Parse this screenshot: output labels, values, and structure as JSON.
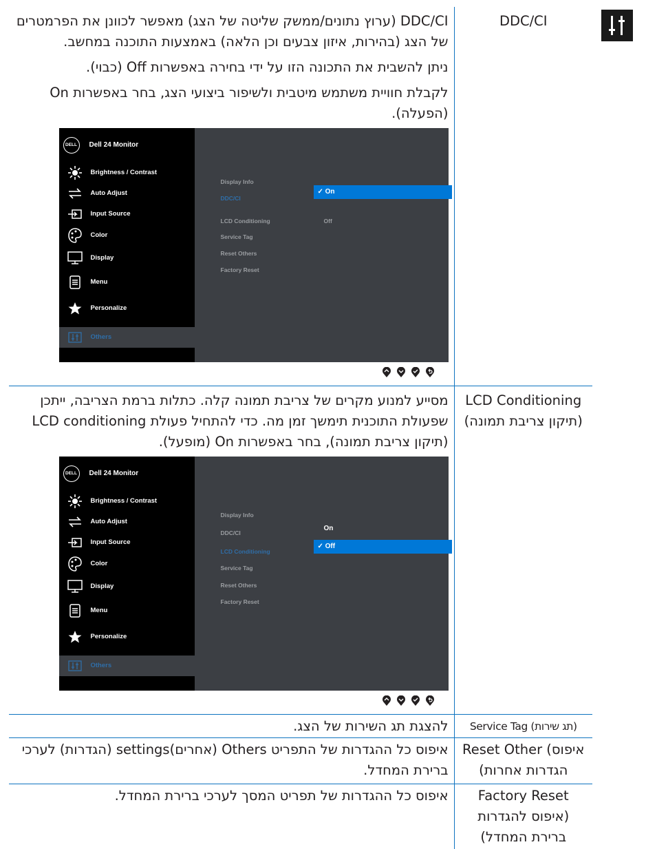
{
  "side_icon": "others-sliders-icon",
  "rows": [
    {
      "label_line1": "DDC/CI",
      "label_line2": "",
      "paragraphs": [
        "DDC/CI (ערוץ נתונים/ממשק שליטה של הצג) מאפשר לכוונן את הפרמטרים של הצג (בהירות, איזון צבעים וכן הלאה) באמצעות התוכנה במחשב.",
        "ניתן להשבית את התכונה הזו על ידי בחירה באפשרות Off (כבוי).",
        "לקבלת חוויית משתמש מיטבית ולשיפור ביצועי הצג, בחר באפשרות On (הפעלה)."
      ]
    },
    {
      "label_line1": "LCD Conditioning",
      "label_line2": "(תיקון צריבת תמונה)",
      "paragraphs": [
        "מסייע למנוע מקרים של צריבת תמונה קלה. כתלות ברמת הצריבה, ייתכן שפעולת התוכנית תימשך זמן מה. כדי להתחיל פעולת LCD conditioning (תיקון צריבת תמונה), בחר באפשרות On (מופעל)."
      ]
    },
    {
      "label_line1": "Service Tag (תג שירות)",
      "label_line2": "",
      "paragraphs": [
        "להצגת תג השירות של הצג."
      ]
    },
    {
      "label_line1": "Reset Other (איפוס",
      "label_line2": "הגדרות אחרות)",
      "paragraphs": [
        "איפוס כל ההגדרות של התפריט Others (אחרים)settings (הגדרות) לערכי ברירת המחדל."
      ]
    },
    {
      "label_line1": "Factory Reset",
      "label_line2": "(איפוס להגדרות ברירת המחדל)",
      "paragraphs": [
        "איפוס כל ההגדרות של תפריט המסך לערכי ברירת המחדל."
      ]
    }
  ],
  "osd": {
    "logo": "DELL",
    "title": "Dell 24 Monitor",
    "menu": [
      {
        "label": "Brightness / Contrast",
        "icon": "brightness-icon"
      },
      {
        "label": "Auto Adjust",
        "icon": "auto-adjust-icon"
      },
      {
        "label": "Input Source",
        "icon": "input-source-icon"
      },
      {
        "label": "Color",
        "icon": "color-icon"
      },
      {
        "label": "Display",
        "icon": "display-icon"
      },
      {
        "label": "Menu",
        "icon": "menu-icon"
      },
      {
        "label": "Personalize",
        "icon": "star-icon"
      },
      {
        "label": "Others",
        "icon": "others-icon"
      }
    ],
    "sub_items": [
      "Display Info",
      "DDC/CI",
      "LCD Conditioning",
      "Service Tag",
      "Reset Others",
      "Factory Reset"
    ],
    "screen1": {
      "selected_option": "✓ On",
      "other_option": "Off"
    },
    "screen2": {
      "selected_option": "✓ Off",
      "other_option": "On"
    }
  }
}
